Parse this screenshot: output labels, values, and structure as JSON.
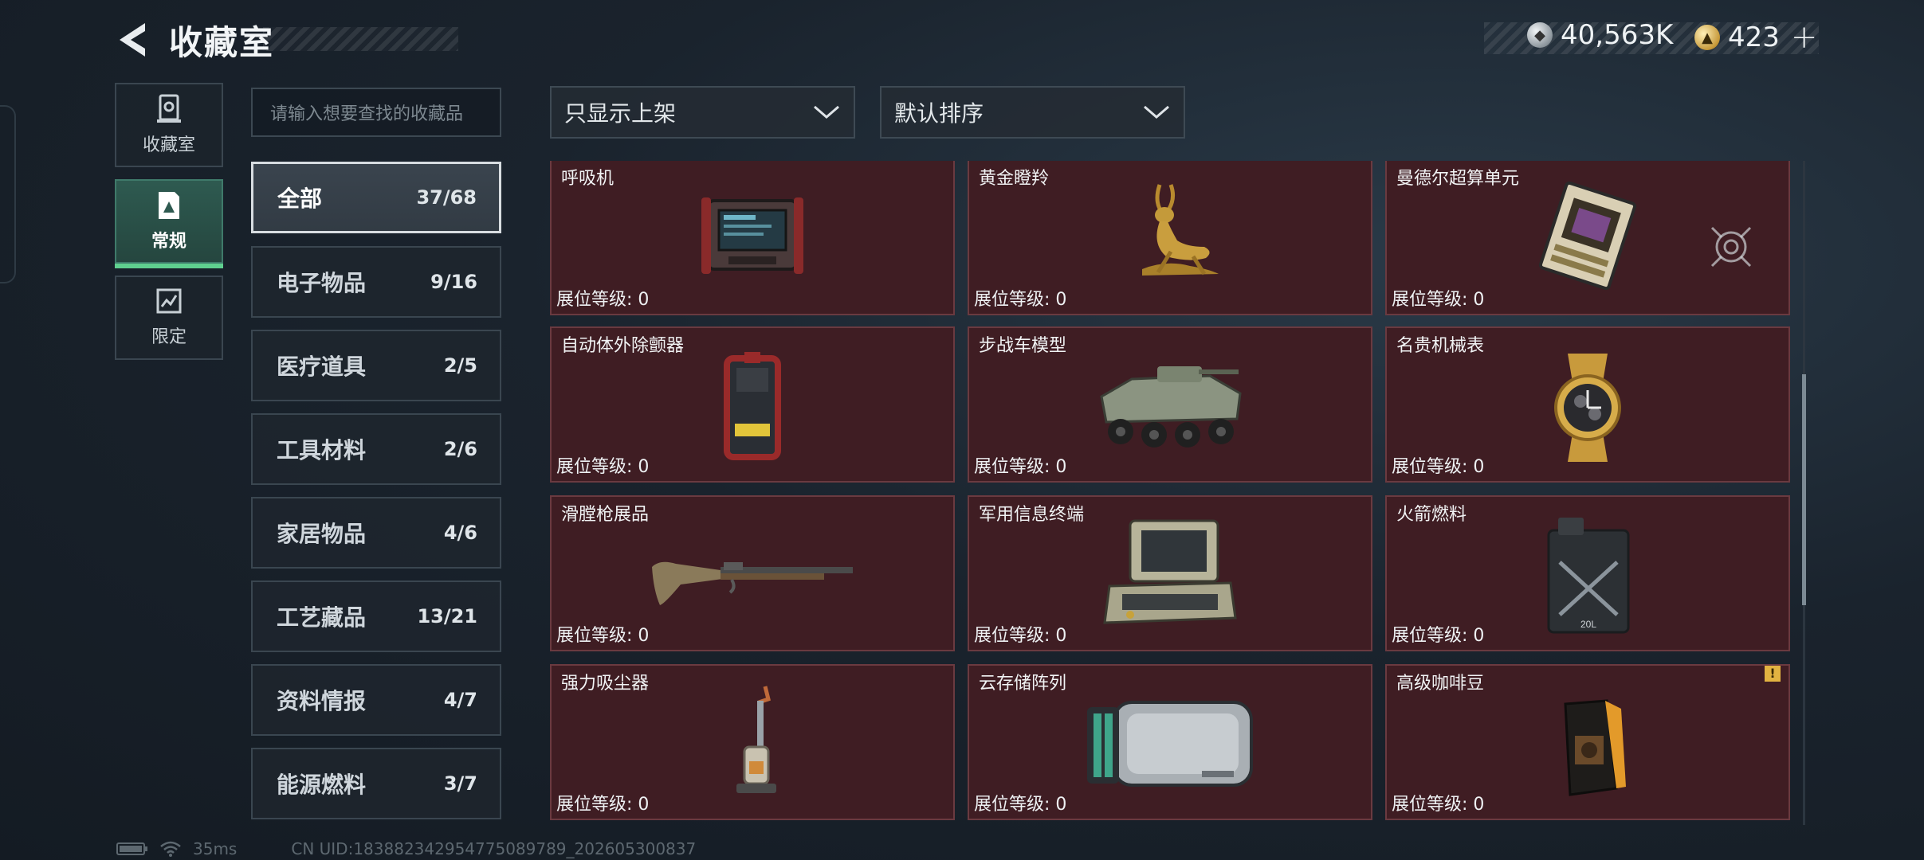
{
  "header": {
    "title": "收藏室",
    "currencies": [
      {
        "icon": "silver-coin-icon",
        "value": "40,563K"
      },
      {
        "icon": "gold-coin-icon",
        "value": "423"
      }
    ],
    "add_label": "+"
  },
  "sidebar": {
    "tabs": [
      {
        "label": "收藏室",
        "icon": "collection-room-icon",
        "active": false
      },
      {
        "label": "常规",
        "icon": "regular-icon",
        "active": true
      },
      {
        "label": "限定",
        "icon": "limited-icon",
        "active": false
      }
    ]
  },
  "search": {
    "placeholder": "请输入想要查找的收藏品"
  },
  "filters": {
    "display": "只显示上架",
    "sort": "默认排序"
  },
  "categories": [
    {
      "name": "全部",
      "count": "37/68",
      "active": true
    },
    {
      "name": "电子物品",
      "count": "9/16"
    },
    {
      "name": "医疗道具",
      "count": "2/5"
    },
    {
      "name": "工具材料",
      "count": "2/6"
    },
    {
      "name": "家居物品",
      "count": "4/6"
    },
    {
      "name": "工艺藏品",
      "count": "13/21"
    },
    {
      "name": "资料情报",
      "count": "4/7"
    },
    {
      "name": "能源燃料",
      "count": "3/7"
    }
  ],
  "level_prefix": "展位等级: ",
  "items": [
    {
      "name": "呼吸机",
      "level": "0"
    },
    {
      "name": "黄金瞪羚",
      "level": "0"
    },
    {
      "name": "曼德尔超算单元",
      "level": "0"
    },
    {
      "name": "自动体外除颤器",
      "level": "0"
    },
    {
      "name": "步战车模型",
      "level": "0"
    },
    {
      "name": "名贵机械表",
      "level": "0"
    },
    {
      "name": "滑膛枪展品",
      "level": "0"
    },
    {
      "name": "军用信息终端",
      "level": "0"
    },
    {
      "name": "火箭燃料",
      "level": "0"
    },
    {
      "name": "强力吸尘器",
      "level": "0"
    },
    {
      "name": "云存储阵列",
      "level": "0"
    },
    {
      "name": "高级咖啡豆",
      "level": "0"
    }
  ],
  "footer": {
    "ping": "35ms",
    "uid": "CN UID:183882342954775089789_202605300837"
  },
  "colors": {
    "card_bg": "#3f1d23",
    "active_tab": "#2e5a50",
    "active_underline": "#5fd08f",
    "warning": "#e2b341"
  }
}
